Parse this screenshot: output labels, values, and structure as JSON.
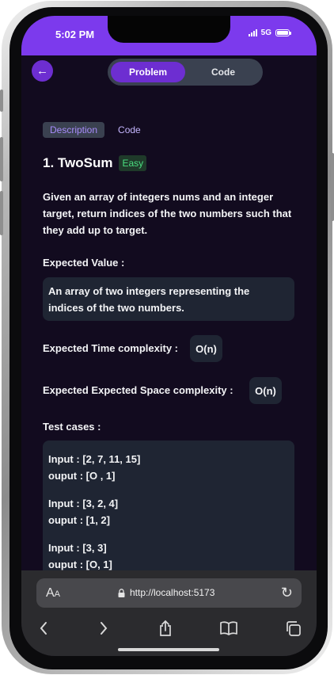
{
  "status": {
    "time": "5:02 PM",
    "network": "5G"
  },
  "toggle": {
    "problem": "Problem",
    "code": "Code"
  },
  "subtabs": {
    "description": "Description",
    "code": "Code"
  },
  "problem": {
    "title": "1. TwoSum",
    "difficulty": "Easy",
    "description": "Given an array of integers nums and an integer target, return indices of the two numbers such that they add up to target.",
    "expected_value_label": "Expected Value :",
    "expected_value": "An array of two integers representing the indices of the two numbers.",
    "time_label": "Expected Time complexity :",
    "time_value": "O(n)",
    "space_label": "Expected Expected Space complexity :",
    "space_value": "O(n)",
    "test_cases_label": "Test cases :",
    "test_cases": [
      {
        "input": "Input : [2, 7, 11, 15]",
        "output": "ouput : [O , 1]"
      },
      {
        "input": "Input : [3, 2, 4]",
        "output": "ouput : [1, 2]"
      },
      {
        "input": "Input : [3, 3]",
        "output": "ouput : [O, 1]"
      }
    ]
  },
  "browser": {
    "text_size": "AA",
    "url": "http://localhost:5173"
  },
  "colors": {
    "accent": "#7c3aed",
    "button": "#6d2ed1",
    "background": "#120b1f",
    "card": "#1f2533",
    "easy": "#4ade80"
  }
}
